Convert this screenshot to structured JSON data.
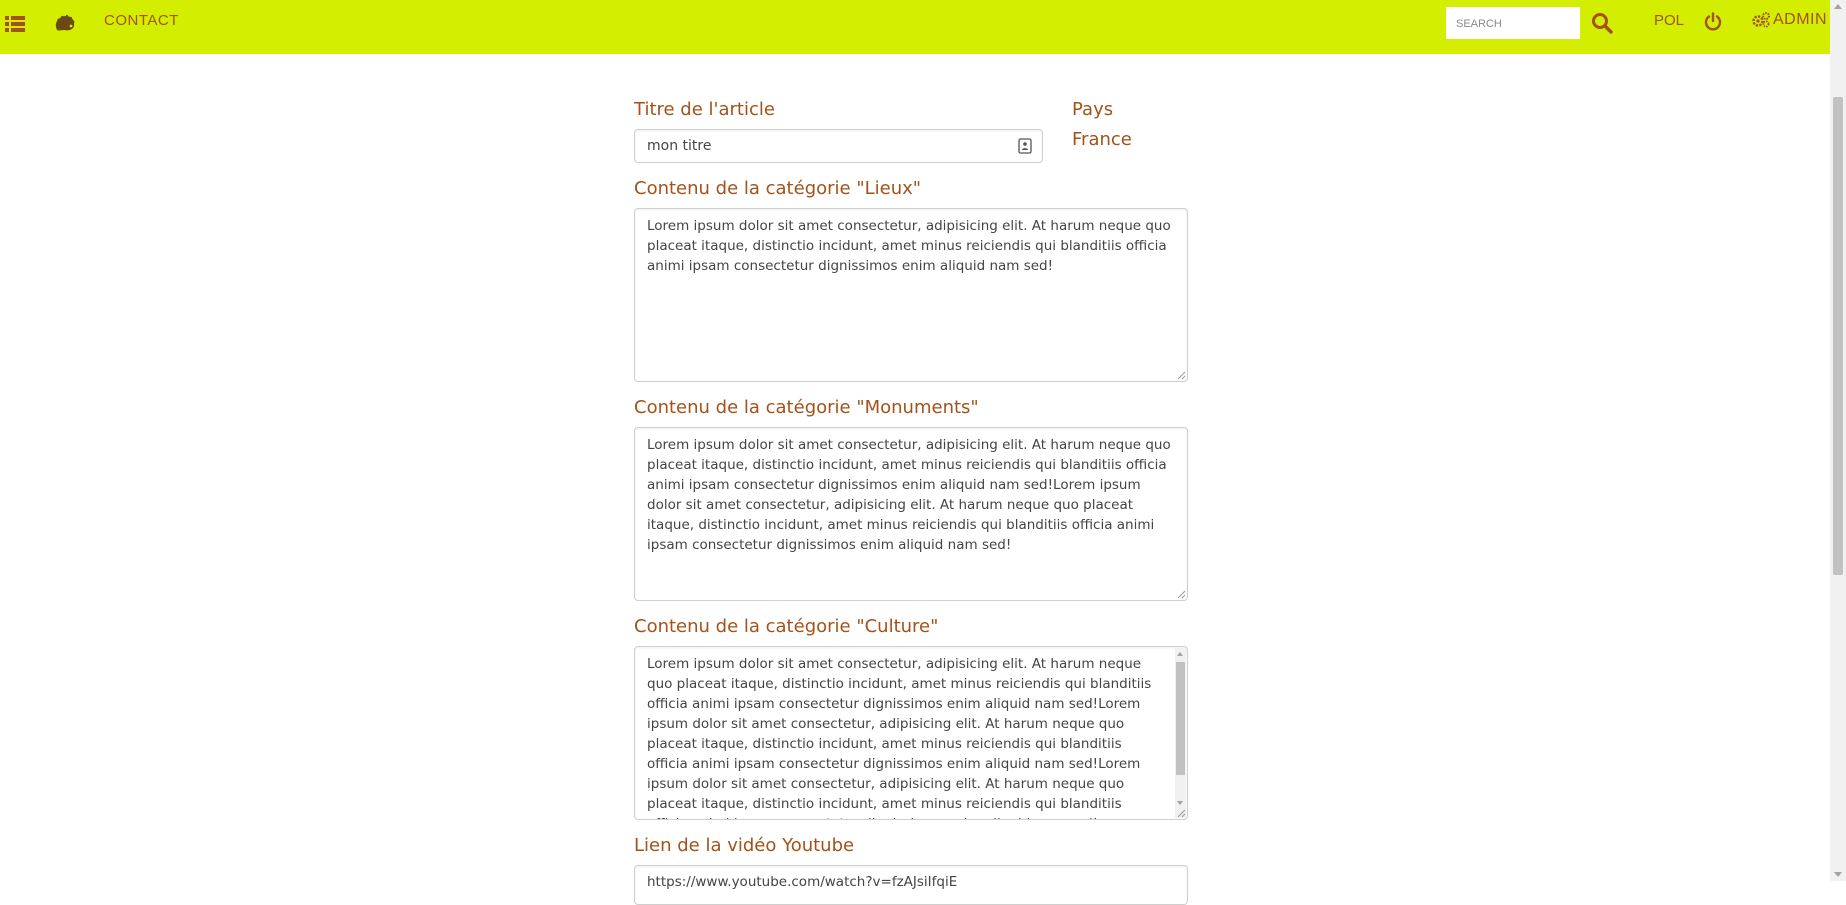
{
  "topbar": {
    "color": "#d3ee00",
    "text_color": "#a35219",
    "menu_icon": "list-icon",
    "logo_icon": "hedgehog-icon",
    "contact_label": "Contact",
    "search": {
      "placeholder": "Search",
      "value": ""
    },
    "search_icon": "search-icon",
    "language": "POL",
    "power_icon": "power-icon",
    "admin_icon": "gears-icon",
    "admin_label": "ADMIN"
  },
  "form": {
    "title": {
      "label": "Titre de l'article",
      "value": "mon  titre"
    },
    "country": {
      "label": "Pays",
      "value": "France"
    },
    "lieux": {
      "label": "Contenu de la catégorie \"Lieux\"",
      "value": "Lorem ipsum dolor sit amet consectetur, adipisicing elit. At harum neque quo placeat itaque, distinctio incidunt, amet minus reiciendis qui blanditiis officia animi ipsam consectetur dignissimos enim aliquid nam sed!"
    },
    "monuments": {
      "label": "Contenu de la catégorie \"Monuments\"",
      "value": "Lorem ipsum dolor sit amet consectetur, adipisicing elit. At harum neque quo placeat itaque, distinctio incidunt, amet minus reiciendis qui blanditiis officia animi ipsam consectetur dignissimos enim aliquid nam sed!Lorem ipsum dolor sit amet consectetur, adipisicing elit. At harum neque quo placeat itaque, distinctio incidunt, amet minus reiciendis qui blanditiis officia animi ipsam consectetur dignissimos enim aliquid nam sed!"
    },
    "culture": {
      "label": "Contenu de la catégorie \"Culture\"",
      "value": "Lorem ipsum dolor sit amet consectetur, adipisicing elit. At harum neque quo placeat itaque, distinctio incidunt, amet minus reiciendis qui blanditiis officia animi ipsam consectetur dignissimos enim aliquid nam sed!Lorem ipsum dolor sit amet consectetur, adipisicing elit. At harum neque quo placeat itaque, distinctio incidunt, amet minus reiciendis qui blanditiis officia animi ipsam consectetur dignissimos enim aliquid nam sed!Lorem ipsum dolor sit amet consectetur, adipisicing elit. At harum neque quo placeat itaque, distinctio incidunt, amet minus reiciendis qui blanditiis officia animi ipsam consectetur dignissimos enim aliquid nam sed!"
    },
    "youtube": {
      "label": "Lien de la vidéo Youtube",
      "value": "https://www.youtube.com/watch?v=fzAJsiIfqiE"
    }
  }
}
